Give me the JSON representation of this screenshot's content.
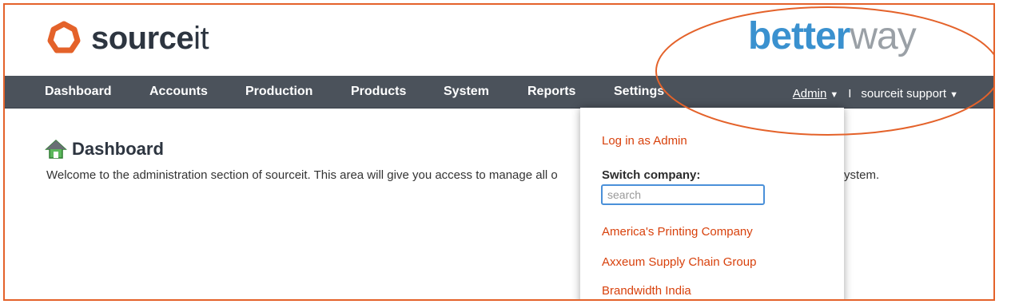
{
  "brand": {
    "logo_bold": "source",
    "logo_light": "it",
    "partner_bold": "better",
    "partner_light": "way"
  },
  "colors": {
    "accent": "#e4622a",
    "nav_bg": "#4b525b",
    "link": "#d8410c",
    "partner_blue": "#3a91cf"
  },
  "nav": {
    "items": [
      {
        "label": "Dashboard"
      },
      {
        "label": "Accounts"
      },
      {
        "label": "Production"
      },
      {
        "label": "Products"
      },
      {
        "label": "System"
      },
      {
        "label": "Reports"
      },
      {
        "label": "Settings"
      }
    ],
    "admin_label": "Admin",
    "separator": "I",
    "support_label": "sourceit support"
  },
  "page": {
    "title": "Dashboard",
    "title_icon": "home-icon",
    "welcome_text": "Welcome to the administration section of sourceit. This area will give you access to manage all o",
    "welcome_tail": "ystem."
  },
  "dropdown": {
    "login_as": "Log in as Admin",
    "switch_label": "Switch company:",
    "search_placeholder": "search",
    "companies": [
      {
        "name": "America's Printing Company"
      },
      {
        "name": "Axxeum Supply Chain Group"
      },
      {
        "name": "Brandwidth India"
      }
    ]
  }
}
